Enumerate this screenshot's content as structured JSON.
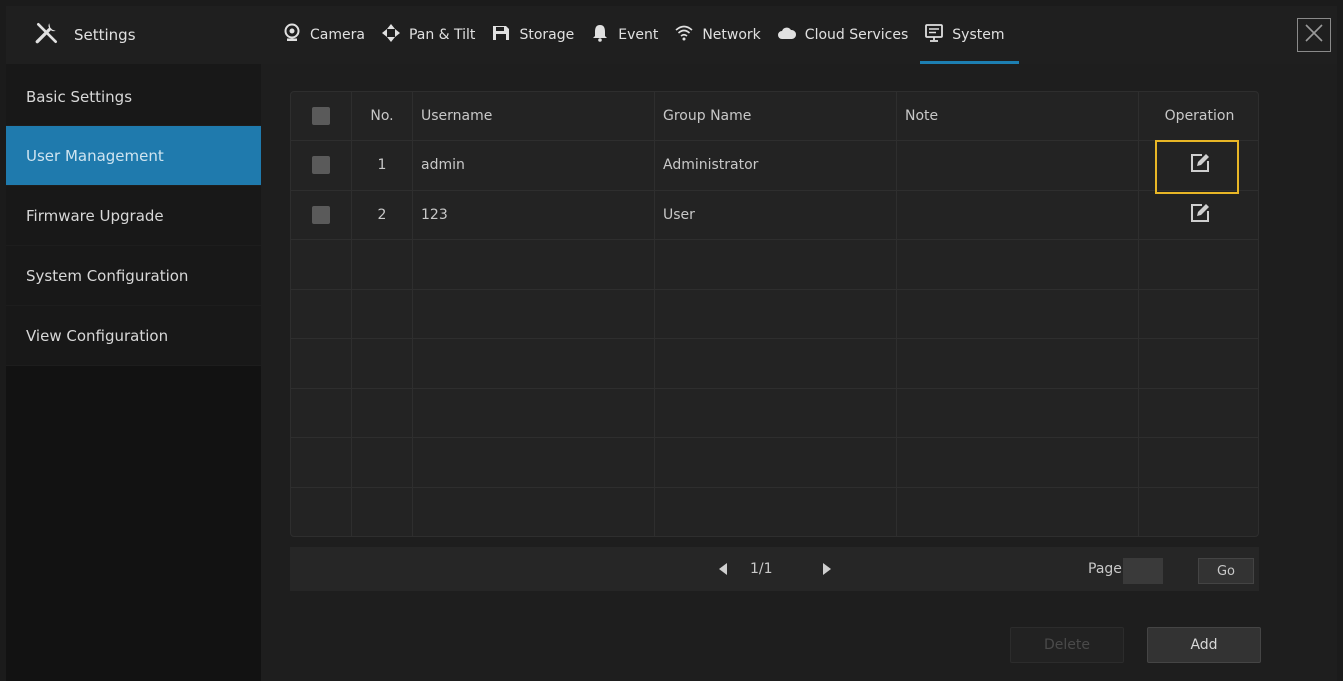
{
  "header": {
    "brand": "Settings",
    "tabs": [
      {
        "label": "Camera",
        "icon": "camera-icon"
      },
      {
        "label": "Pan & Tilt",
        "icon": "pan-tilt-icon"
      },
      {
        "label": "Storage",
        "icon": "storage-icon"
      },
      {
        "label": "Event",
        "icon": "bell-icon"
      },
      {
        "label": "Network",
        "icon": "wifi-icon"
      },
      {
        "label": "Cloud Services",
        "icon": "cloud-icon"
      },
      {
        "label": "System",
        "icon": "monitor-icon",
        "active": true
      }
    ]
  },
  "sidebar": {
    "items": [
      {
        "label": "Basic Settings"
      },
      {
        "label": "User Management",
        "active": true
      },
      {
        "label": "Firmware Upgrade"
      },
      {
        "label": "System Configuration"
      },
      {
        "label": "View Configuration"
      }
    ]
  },
  "table": {
    "columns": [
      "No.",
      "Username",
      "Group Name",
      "Note",
      "Operation"
    ],
    "rows": [
      {
        "no": "1",
        "username": "admin",
        "group": "Administrator",
        "note": ""
      },
      {
        "no": "2",
        "username": "123",
        "group": "User",
        "note": ""
      }
    ]
  },
  "pager": {
    "page_text": "1/1",
    "page_label": "Page",
    "page_value": "",
    "go_label": "Go"
  },
  "actions": {
    "delete_label": "Delete",
    "add_label": "Add"
  },
  "colors": {
    "accent": "#1f7aad",
    "highlight": "#e8b626"
  }
}
